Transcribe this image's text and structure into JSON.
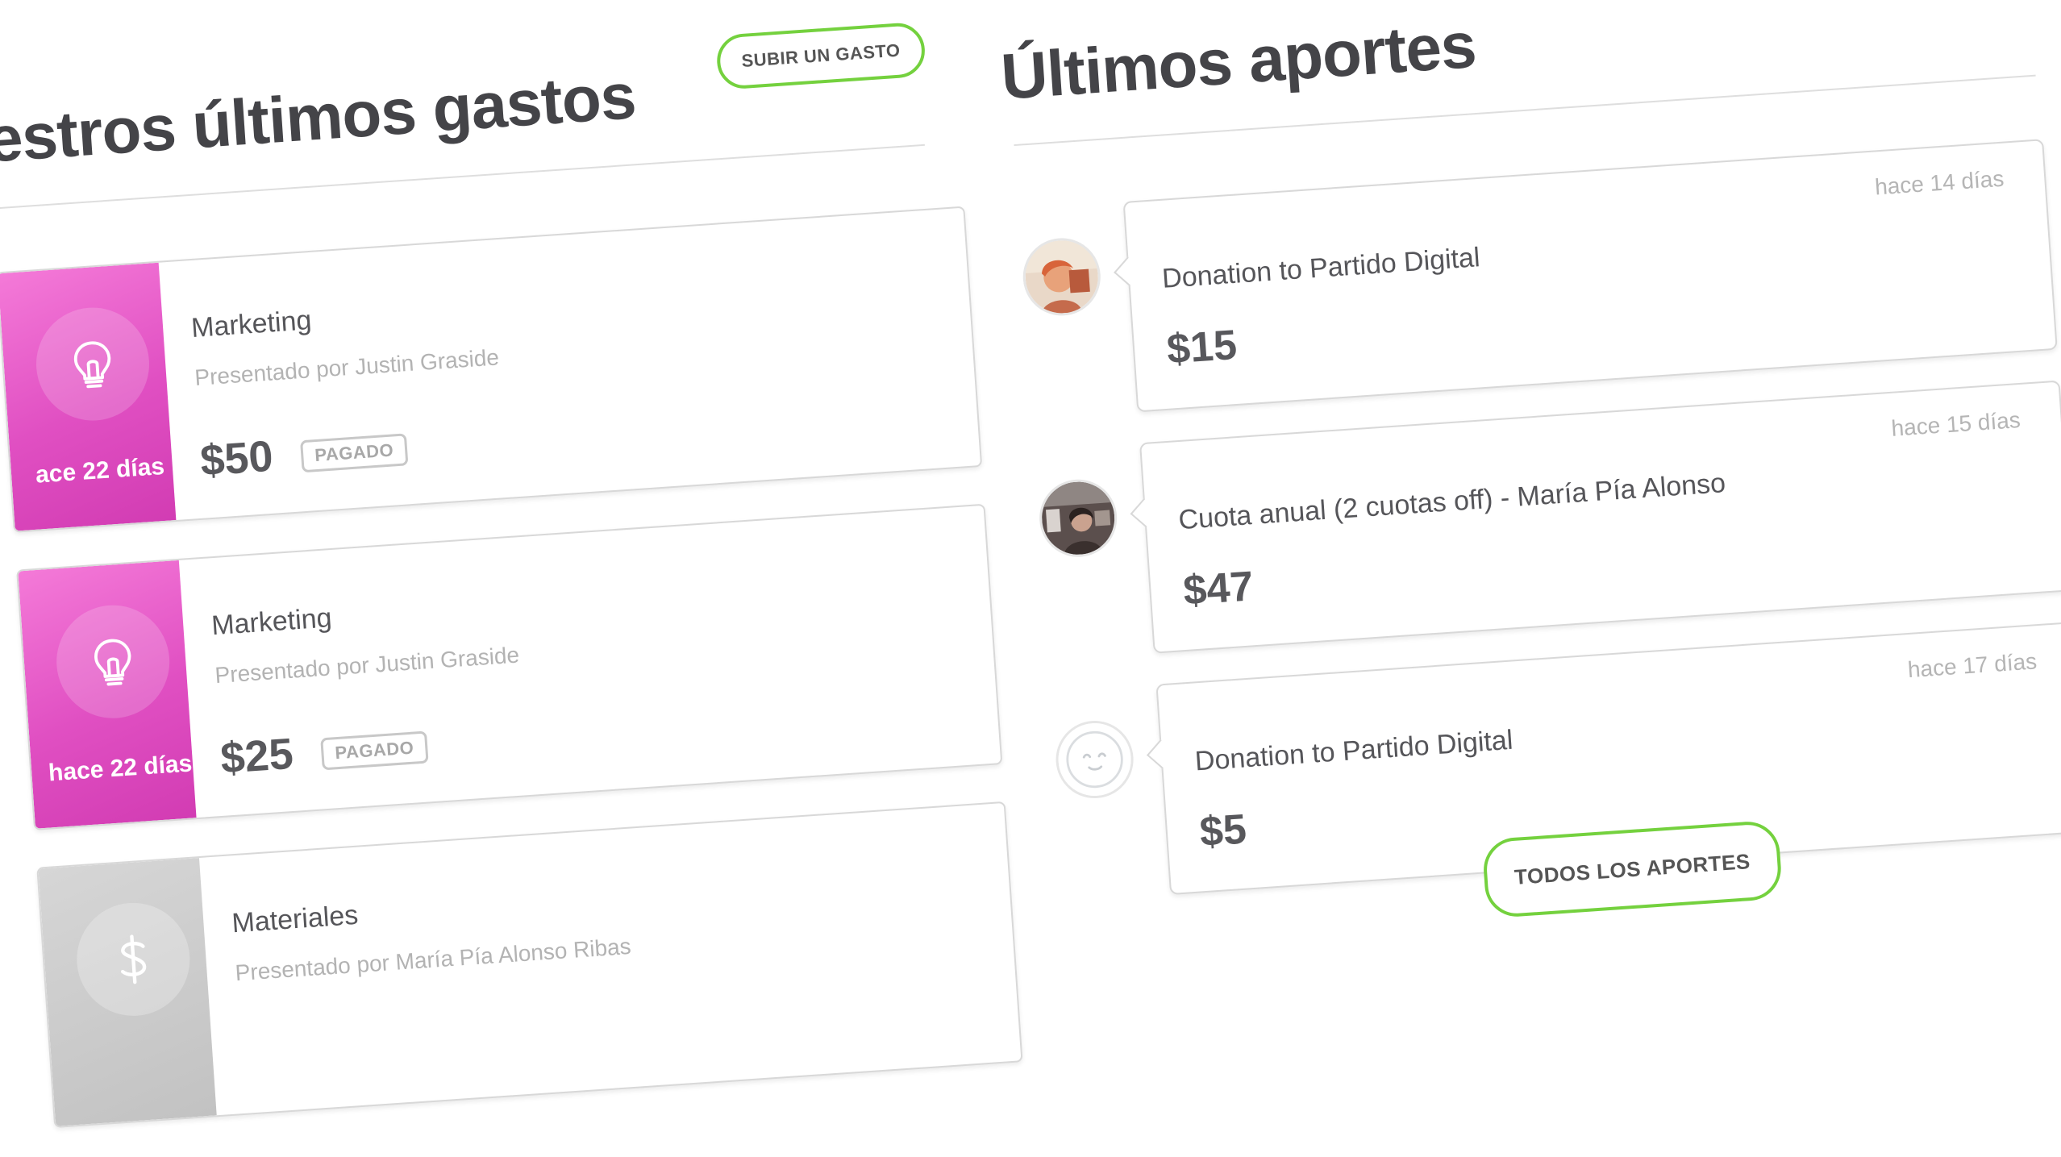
{
  "expenses_section": {
    "title": "estros últimos gastos",
    "upload_button": "SUBIR UN GASTO",
    "items": [
      {
        "category": "Marketing",
        "presenter": "Presentado por Justin Graside",
        "amount": "$50",
        "status": "PAGADO",
        "date": "ace 22 días",
        "icon": "lightbulb-icon",
        "color": "#e04fc2"
      },
      {
        "category": "Marketing",
        "presenter": "Presentado por Justin Graside",
        "amount": "$25",
        "status": "PAGADO",
        "date": "hace 22 días",
        "icon": "lightbulb-icon",
        "color": "#e04fc2"
      },
      {
        "category": "Materiales",
        "presenter": "Presentado por María Pía Alonso Ribas",
        "amount": "",
        "status": "",
        "date": "",
        "icon": "dollar-icon",
        "color": "#c8c8c8"
      }
    ]
  },
  "contributions_section": {
    "title": "Últimos aportes",
    "items": [
      {
        "description": "Donation to Partido Digital",
        "amount": "$15",
        "time": "hace 14 días"
      },
      {
        "description": "Cuota anual (2 cuotas off) - María Pía Alonso",
        "amount": "$47",
        "time": "hace 15 días"
      },
      {
        "description": "Donation to Partido Digital",
        "amount": "$5",
        "time": "hace 17 días"
      }
    ],
    "all_button": "TODOS LOS APORTES"
  },
  "colors": {
    "accent_green": "#74d13e",
    "expense_pink": "#e04fc2",
    "expense_gray": "#c8c8c8"
  }
}
